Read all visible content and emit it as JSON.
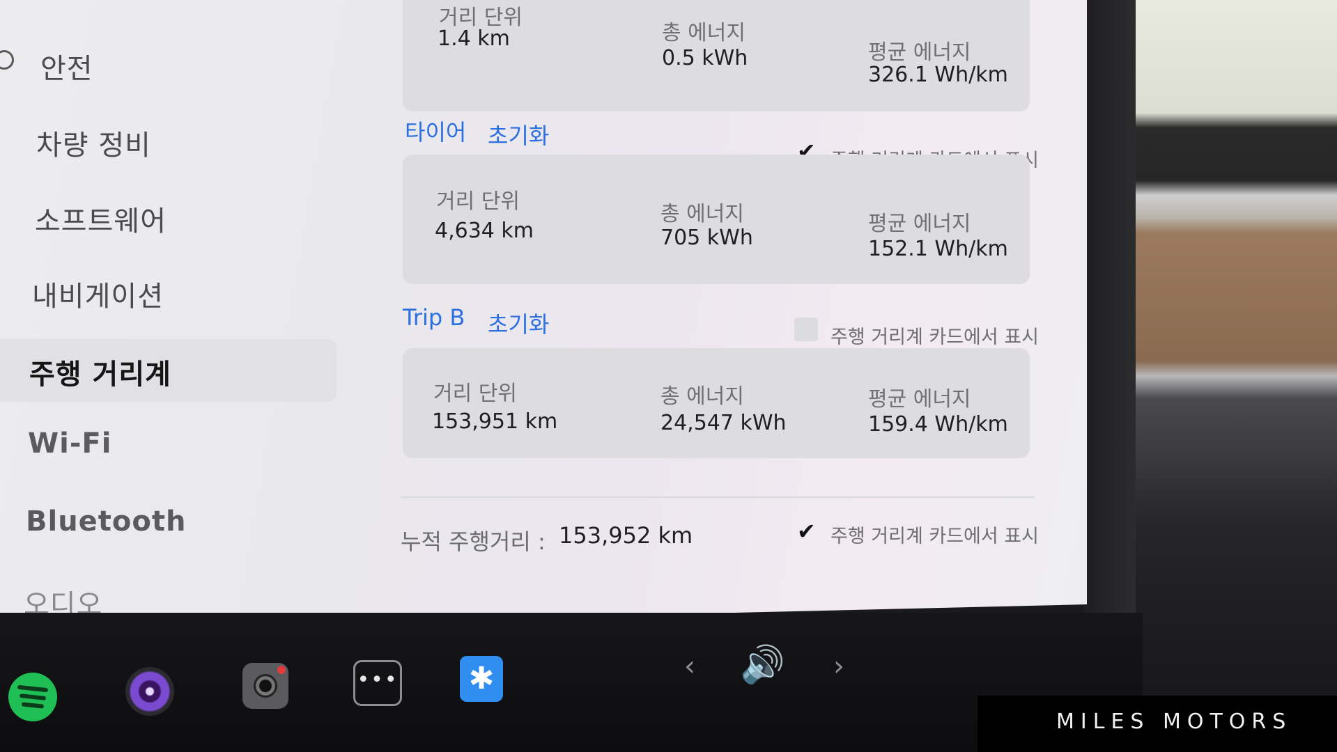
{
  "sidebar": {
    "items": [
      {
        "label": "안전"
      },
      {
        "label": "차량 정비"
      },
      {
        "label": "소프트웨어"
      },
      {
        "label": "내비게이션"
      },
      {
        "label": "주행 거리계",
        "active": true
      },
      {
        "label": "Wi-Fi"
      },
      {
        "label": "Bluetooth"
      },
      {
        "label": "오디오"
      }
    ]
  },
  "sections": {
    "top_card": {
      "distance_label": "거리 단위",
      "distance_value": "1.4 km",
      "energy_label": "총 에너지",
      "energy_value": "0.5 kWh",
      "avg_label": "평균 에너지",
      "avg_value": "326.1 Wh/km"
    },
    "tire": {
      "title": "타이어",
      "reset_label": "초기화",
      "show_label": "주행 거리계 카드에서 표시",
      "show_checked": true,
      "distance_label": "거리 단위",
      "distance_value": "4,634 km",
      "energy_label": "총 에너지",
      "energy_value": "705 kWh",
      "avg_label": "평균 에너지",
      "avg_value": "152.1 Wh/km"
    },
    "trip_b": {
      "title": "Trip B",
      "reset_label": "초기화",
      "show_label": "주행 거리계 카드에서 표시",
      "show_checked": false,
      "distance_label": "거리 단위",
      "distance_value": "153,951 km",
      "energy_label": "총 에너지",
      "energy_value": "24,547 kWh",
      "avg_label": "평균 에너지",
      "avg_value": "159.4 Wh/km"
    }
  },
  "odometer": {
    "label": "누적 주행거리 :",
    "value": "153,952 km",
    "show_label": "주행 거리계 카드에서 표시",
    "show_checked": true
  },
  "taskbar": {
    "more_glyph": "•••",
    "bluetooth_glyph": "✱",
    "prev_glyph": "‹",
    "next_glyph": "›",
    "volume_glyph": "🔊"
  },
  "watermark": "MILES MOTORS",
  "colors": {
    "accent": "#2b6fe0",
    "spotify": "#1fbf55",
    "bluetooth": "#2f8ef0"
  }
}
